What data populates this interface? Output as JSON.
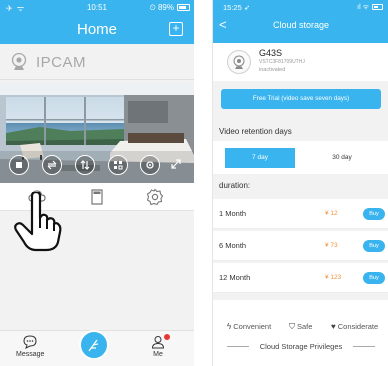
{
  "left_phone": {
    "status_bar": {
      "left": "✈ ᯤ",
      "time": "10:51",
      "right": "⏲ 89%"
    },
    "nav": {
      "title": "Home",
      "add_icon": "plus-square-icon"
    },
    "camera": {
      "name": "IPCAM",
      "icon": "webcam-icon"
    },
    "preview_controls": [
      {
        "name": "stop-icon"
      },
      {
        "name": "loop-icon"
      },
      {
        "name": "flip-vertical-icon"
      },
      {
        "name": "mirror-icon"
      },
      {
        "name": "settings-icon"
      }
    ],
    "tools": [
      {
        "name": "cloud-icon"
      },
      {
        "name": "sd-card-icon"
      },
      {
        "name": "gear-icon"
      }
    ],
    "tabbar": {
      "message_label": "Message",
      "me_label": "Me"
    }
  },
  "right_phone": {
    "status_bar": {
      "time": "15:25 ➶",
      "right": "ıl ᯤ"
    },
    "header": {
      "title": "Cloud storage",
      "back": "<"
    },
    "device": {
      "name": "G43S",
      "id": "VSTC3F81709UTHJ",
      "status": "inactivated"
    },
    "trial_button": "Free Trial (video save seven days)",
    "retention_label": "Video retention days",
    "retention_options": [
      "7 day",
      "30 day"
    ],
    "retention_selected": "7 day",
    "duration_label": "duration:",
    "plans": [
      {
        "name": "1 Month",
        "price": "¥ 12",
        "buy": "Buy"
      },
      {
        "name": "6 Month",
        "price": "¥ 73",
        "buy": "Buy"
      },
      {
        "name": "12 Month",
        "price": "¥ 123",
        "buy": "Buy"
      }
    ],
    "perks": [
      {
        "icon": "lightning-icon",
        "label": "Convenient"
      },
      {
        "icon": "shield-icon",
        "label": "Safe"
      },
      {
        "icon": "heart-icon",
        "label": "Considerate"
      }
    ],
    "privileges_title": "Cloud Storage Privileges"
  },
  "colors": {
    "accent": "#39b4ee",
    "price": "#f0933b",
    "badge": "#e53935"
  }
}
